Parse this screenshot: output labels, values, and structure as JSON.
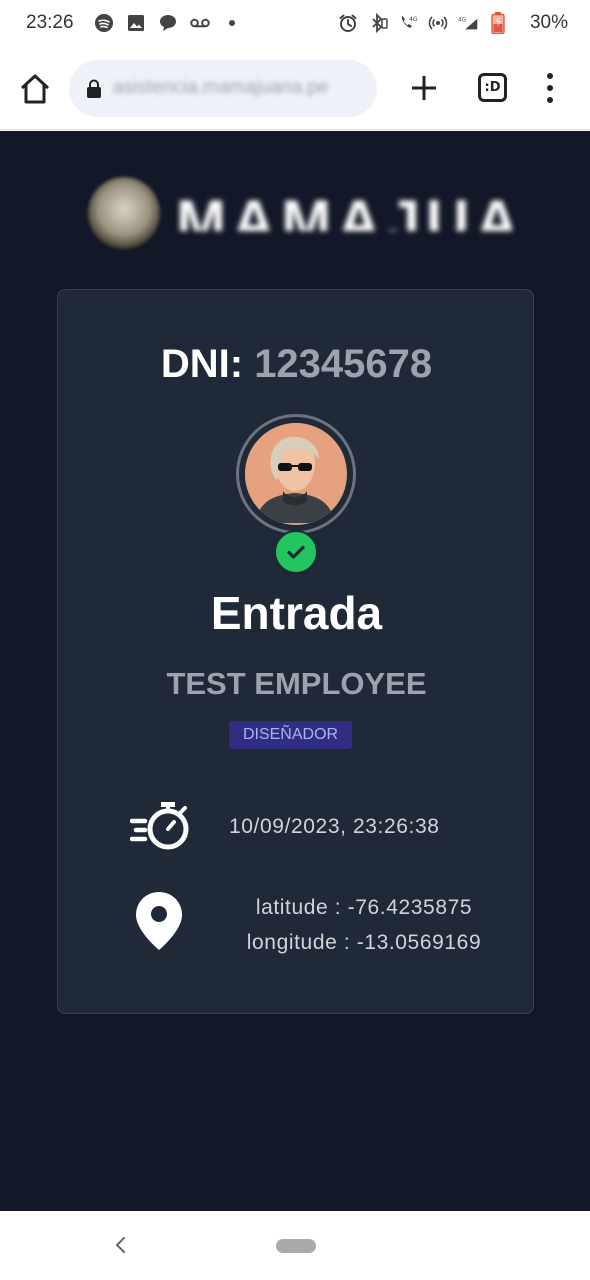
{
  "status_bar": {
    "time": "23:26",
    "battery_percent": "30%",
    "network": "4G",
    "icons": [
      "spotify-icon",
      "image-icon",
      "chat-icon",
      "voicemail-icon",
      "dot-icon",
      "alarm-icon",
      "bluetooth-icon",
      "wifi-call-icon",
      "hotspot-icon",
      "signal-icon",
      "battery-icon"
    ]
  },
  "browser": {
    "url": "asistencia.mamajuana.pe",
    "tab_label": ":D",
    "buttons": [
      "home-icon",
      "lock-icon",
      "plus-icon",
      "tabs-button",
      "more-icon"
    ]
  },
  "brand": {
    "name": "MAMAJUANA"
  },
  "card": {
    "dni_label": "DNI:",
    "dni_value": "12345678",
    "status_icon": "check-icon",
    "event_title": "Entrada",
    "employee_name": "TEST EMPLOYEE",
    "role": "DISEÑADOR",
    "timestamp": "10/09/2023, 23:26:38",
    "latitude_text": "latitude : -76.4235875",
    "longitude_text": "longitude : -13.0569169"
  },
  "colors": {
    "page_bg": "#121827",
    "card_bg": "#1f2937",
    "success": "#22c55e",
    "badge_bg": "#312e81",
    "badge_text": "#a5b4fc",
    "muted_text": "#9ca3af"
  }
}
